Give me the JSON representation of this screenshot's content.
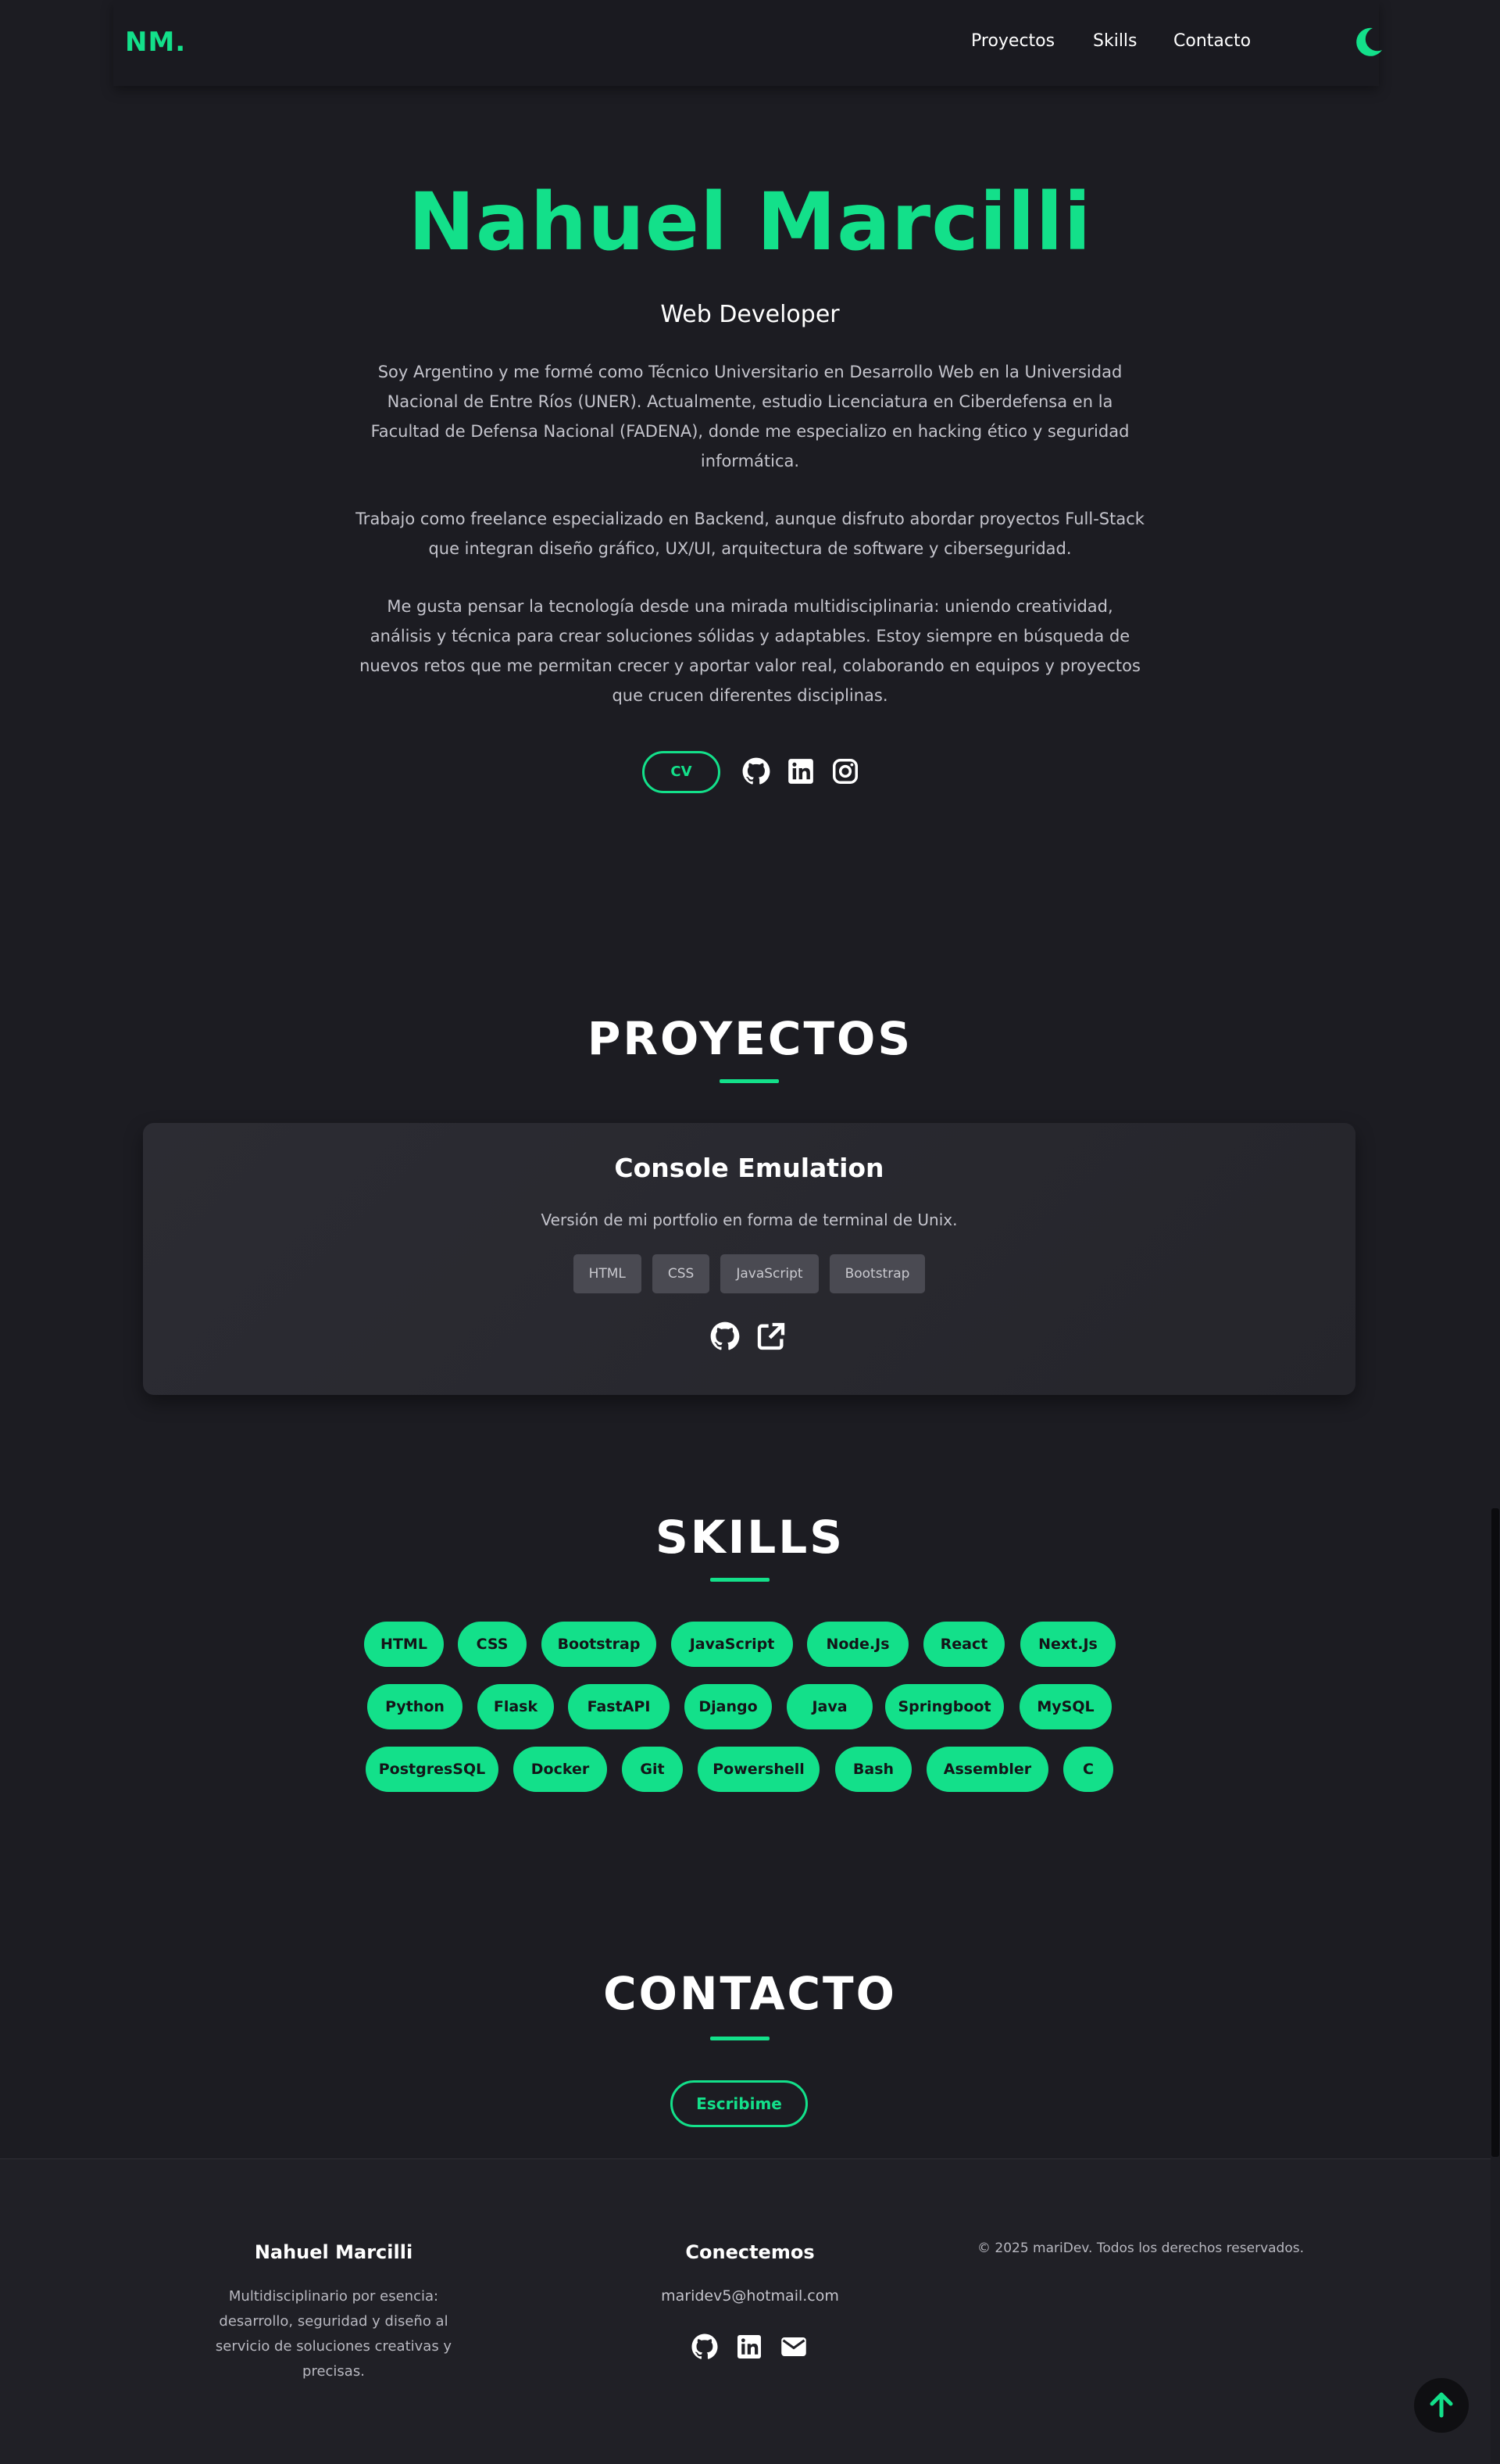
{
  "colors": {
    "accent": "#13e08a",
    "background": "#1c1c22",
    "card": "#2a2a31",
    "tag": "#4a4a52"
  },
  "nav": {
    "logo": "NM.",
    "links": [
      "Proyectos",
      "Skills",
      "Contacto"
    ],
    "theme_icon": "moon-icon"
  },
  "hero": {
    "name": "Nahuel Marcilli",
    "role": "Web Developer",
    "paragraphs": [
      "Soy Argentino y me formé como Técnico Universitario en Desarrollo Web en la Universidad Nacional de Entre Ríos (UNER). Actualmente, estudio Licenciatura en Ciberdefensa en la Facultad de Defensa Nacional (FADENA), donde me especializo en hacking ético y seguridad informática.",
      "Trabajo como freelance especializado en Backend, aunque disfruto abordar proyectos Full-Stack que integran diseño gráfico, UX/UI, arquitectura de software y ciberseguridad.",
      "Me gusta pensar la tecnología desde una mirada multidisciplinaria: uniendo creatividad, análisis y técnica para crear soluciones sólidas y adaptables. Estoy siempre en búsqueda de nuevos retos que me permitan crecer y aportar valor real, colaborando en equipos y proyectos que crucen diferentes disciplinas."
    ],
    "cv_label": "CV",
    "social_icons": [
      "github-icon",
      "linkedin-icon",
      "instagram-icon"
    ]
  },
  "projects": {
    "title": "PROYECTOS",
    "items": [
      {
        "title": "Console Emulation",
        "description": "Versión de mi portfolio en forma de terminal de Unix.",
        "tags": [
          "HTML",
          "CSS",
          "JavaScript",
          "Bootstrap"
        ],
        "icons": [
          "github-icon",
          "external-link-icon"
        ]
      }
    ]
  },
  "skills": {
    "title": "SKILLS",
    "rows": [
      [
        "HTML",
        "CSS",
        "Bootstrap",
        "JavaScript",
        "Node.Js",
        "React",
        "Next.Js"
      ],
      [
        "Python",
        "Flask",
        "FastAPI",
        "Django",
        "Java",
        "Springboot",
        "MySQL"
      ],
      [
        "PostgresSQL",
        "Docker",
        "Git",
        "Powershell",
        "Bash",
        "Assembler",
        "C"
      ]
    ]
  },
  "contact": {
    "title": "CONTACTO",
    "button_label": "Escribime"
  },
  "footer": {
    "name": "Nahuel Marcilli",
    "about": "Multidisciplinario por esencia: desarrollo, seguridad y diseño al servicio de soluciones creativas y precisas.",
    "connect_title": "Conectemos",
    "email": "maridev5@hotmail.com",
    "icons": [
      "github-icon",
      "linkedin-icon",
      "mail-icon"
    ],
    "copyright": "© 2025 mariDev. Todos los derechos reservados."
  },
  "scroll_top_icon": "arrow-up-icon"
}
